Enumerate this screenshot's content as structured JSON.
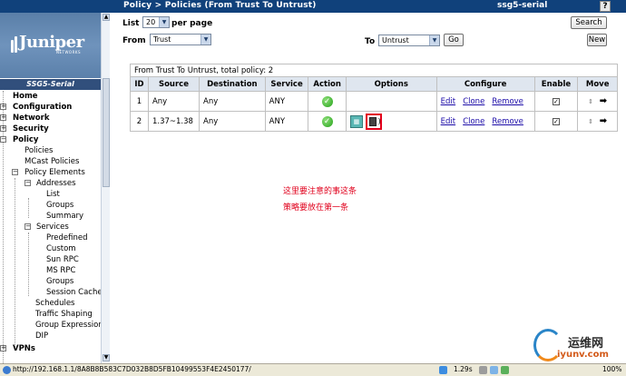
{
  "header": {
    "breadcrumb": "Policy > Policies (From Trust To Untrust)",
    "device_name": "ssg5-serial",
    "help_label": "?"
  },
  "sidebar": {
    "logo_text": "Juniper",
    "logo_subtext": "NETWORKS",
    "model": "SSG5-Serial",
    "nav": [
      {
        "label": "Home"
      },
      {
        "label": "Configuration"
      },
      {
        "label": "Network"
      },
      {
        "label": "Security"
      },
      {
        "label": "Policy"
      },
      {
        "label": "Policies"
      },
      {
        "label": "MCast Policies"
      },
      {
        "label": "Policy Elements"
      },
      {
        "label": "Addresses"
      },
      {
        "label": "List"
      },
      {
        "label": "Groups"
      },
      {
        "label": "Summary"
      },
      {
        "label": "Services"
      },
      {
        "label": "Predefined"
      },
      {
        "label": "Custom"
      },
      {
        "label": "Sun RPC"
      },
      {
        "label": "MS RPC"
      },
      {
        "label": "Groups"
      },
      {
        "label": "Session Cache"
      },
      {
        "label": "Schedules"
      },
      {
        "label": "Traffic Shaping"
      },
      {
        "label": "Group Expression"
      },
      {
        "label": "DIP"
      },
      {
        "label": "VPNs"
      }
    ]
  },
  "controls": {
    "list_label": "List",
    "per_page_value": "20",
    "per_page_label": "per page",
    "from_label": "From",
    "from_value": "Trust",
    "to_label": "To",
    "to_value": "Untrust",
    "go_button": "Go",
    "search_button": "Search",
    "new_button": "New"
  },
  "table": {
    "caption": "From Trust To Untrust, total policy: 2",
    "headers": [
      "ID",
      "Source",
      "Destination",
      "Service",
      "Action",
      "Options",
      "Configure",
      "Enable",
      "Move"
    ],
    "rows": [
      {
        "id": "1",
        "source": "Any",
        "destination": "Any",
        "service": "ANY",
        "edit": "Edit",
        "clone": "Clone",
        "remove": "Remove"
      },
      {
        "id": "2",
        "source": "1.37~1.38",
        "destination": "Any",
        "service": "ANY",
        "edit": "Edit",
        "clone": "Clone",
        "remove": "Remove"
      }
    ]
  },
  "annotation": {
    "line1": "这里要注意的事这条",
    "line2": "策略要放在第一条"
  },
  "statusbar": {
    "url": "http://192.168.1.1/8A8B8B583C7D032B8D5FB10499553F4E2450177/",
    "time": "1.29s",
    "zoom": "100%"
  },
  "watermark": {
    "title": "运维网",
    "site": "iyunv.com"
  },
  "colors": {
    "header_bg": "#10417b",
    "table_header_bg": "#dfe6ef",
    "link": "#1a0aa7",
    "annotation": "#e0001c"
  }
}
